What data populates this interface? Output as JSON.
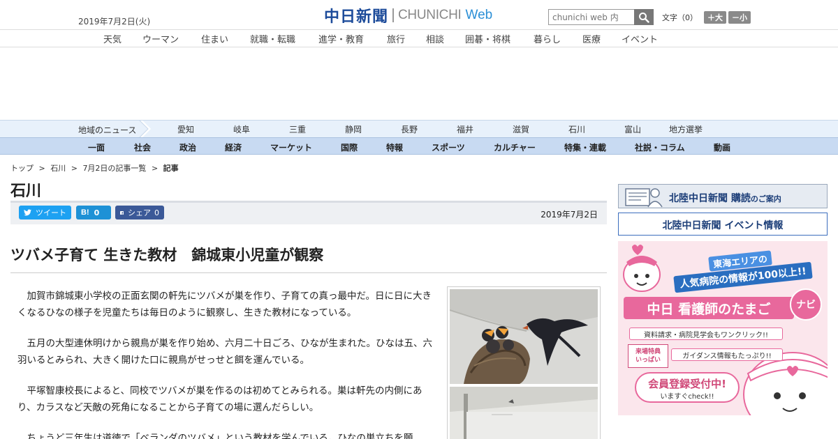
{
  "header": {
    "date": "2019年7月2日(火)",
    "logo_jp": "中日新聞",
    "logo_en": "CHUNICHI",
    "logo_web": "Web",
    "search_placeholder": "chunichi web 内",
    "font_size_label": "文字（0）",
    "font_bigger": "＋大",
    "font_smaller": "－小"
  },
  "category_nav": [
    "天気",
    "ウーマン",
    "住まい",
    "就職・転職",
    "進学・教育",
    "旅行",
    "相談",
    "囲碁・将棋",
    "暮らし",
    "医療",
    "イベント"
  ],
  "region_nav": {
    "label": "地域のニュース",
    "items": [
      "愛知",
      "岐阜",
      "三重",
      "静岡",
      "長野",
      "福井",
      "滋賀",
      "石川",
      "富山",
      "地方選挙"
    ]
  },
  "section_nav": [
    "一面",
    "社会",
    "政治",
    "経済",
    "マーケット",
    "国際",
    "特報",
    "スポーツ",
    "カルチャー",
    "特集・連載",
    "社説・コラム",
    "動画"
  ],
  "breadcrumb": {
    "items": [
      "トップ",
      "石川",
      "7月2日の記事一覧"
    ],
    "current": "記事",
    "separator": ">"
  },
  "section_title": "石川",
  "share": {
    "tweet": "ツイート",
    "hatena_count": "0",
    "facebook": "シェア",
    "facebook_count": "0",
    "date": "2019年7月2日"
  },
  "article": {
    "headline": "ツバメ子育て 生きた教材　錦城東小児童が観察",
    "paragraphs": [
      "加賀市錦城東小学校の正面玄関の軒先にツバメが巣を作り、子育ての真っ最中だ。日に日に大きくなるひなの様子を児童たちは毎日のように観察し、生きた教材になっている。",
      "五月の大型連休明けから親鳥が巣を作り始め、六月二十日ごろ、ひなが生まれた。ひなは五、六羽いるとみられ、大きく開けた口に親鳥がせっせと餌を運んでいる。",
      "平塚智康校長によると、同校でツバメが巣を作るのは初めてとみられる。巣は軒先の内側にあり、カラスなど天敵の死角になることから子育ての場に選んだらしい。",
      "ちょうど三年生は道徳で「ベランダのツバメ」という教材を学んでいる。ひなの巣立ちを願"
    ]
  },
  "sidebar": {
    "subscribe_main": "北陸中日新聞 購読",
    "subscribe_small": "のご案内",
    "event": "北陸中日新聞 イベント情報",
    "ad": {
      "line1": "東海エリアの",
      "line2": "人気病院の情報が100以上!!",
      "title": "中日 看護師のたまご",
      "navi": "ナビ",
      "bullet1": "資料請求・病院見学会もワンクリック!!",
      "tag_top": "来場特典",
      "tag_bottom": "いっぱい",
      "bullet2": "ガイダンス情報もたっぷり!!",
      "register": "会員登録受付中!",
      "register_sub": "いますぐcheck!!"
    }
  },
  "colors": {
    "brand": "#1c4b9a",
    "web_accent": "#2b8fd6",
    "twitter": "#1da1f2",
    "hatena": "#1e91d6",
    "facebook": "#3b5998",
    "ad_pink": "#e8689c"
  }
}
